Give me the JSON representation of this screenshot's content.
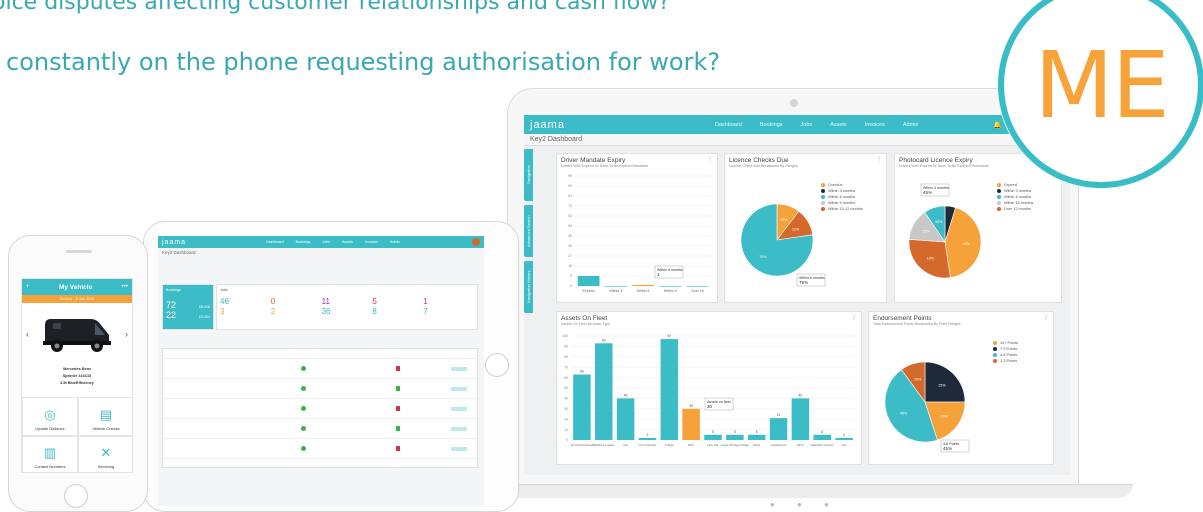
{
  "headline": {
    "line1": "oice disputes affecting customer relationships and cash flow?",
    "line2": "constantly on the phone requesting authorisation for work?"
  },
  "badge": {
    "text": "ME",
    "ring_color": "#38bcc6",
    "text_color": "#f7a33a"
  },
  "colors": {
    "brand": "#3cbcc6",
    "orange": "#f6a23a",
    "navy": "#1e2a3a",
    "grey": "#c8c8c8",
    "rust": "#d4692b"
  },
  "laptop": {
    "logo": "jaama",
    "nav": [
      "Dashboard",
      "Bookings",
      "Jobs",
      "Assets",
      "Invoices",
      "Admin"
    ],
    "icons": [
      "bell-icon",
      "gear-icon",
      "grid-icon"
    ],
    "subtitle": "Key2 Dashboard",
    "side_tabs": [
      "Navigation",
      "Advanced Search",
      "Navigation History"
    ],
    "mandate": {
      "title": "Driver Mandate Expiry",
      "subtitle": "Drivers With Expired Or Soon To Be Expired Mandates",
      "y_ticks": [
        "99",
        "90",
        "81",
        "72",
        "63",
        "54",
        "45",
        "36",
        "27",
        "18",
        "9",
        "0"
      ],
      "categories": [
        "Expired",
        "Within 3",
        "Within 6",
        "Within 9",
        "Over 18"
      ],
      "tooltip": [
        "Within 6 months",
        "1"
      ]
    },
    "licence": {
      "title": "Licence Checks Due",
      "subtitle": "Licence Check Due Breakdown By Ranges",
      "legend": [
        "Overdue",
        "Within 3 months",
        "Within 6 months",
        "Within 9 months",
        "Within 10-12 months"
      ],
      "tooltip": [
        "Within 6 months",
        "75%"
      ],
      "labels": [
        "75%",
        "12%",
        "10%"
      ]
    },
    "photocard": {
      "title": "Photocard Licence Expiry",
      "subtitle": "Drivers With Expired Or Soon To Be Expired Photocards",
      "legend": [
        "Expired",
        "Within 3 months",
        "Within 6 months",
        "Within 12 months",
        "Over 12 months"
      ],
      "tooltip": [
        "Within 3 months",
        "45%"
      ],
      "labels": [
        "45%",
        "30%",
        "15%",
        "10%"
      ]
    },
    "assets": {
      "title": "Assets On Fleet",
      "subtitle": "Assets On Fleet By Asset Type",
      "y_ticks": [
        "100",
        "90",
        "80",
        "70",
        "60",
        "50",
        "40",
        "30",
        "20",
        "10",
        "0"
      ],
      "tooltip": [
        "Assets on fleet",
        "30"
      ]
    },
    "endorsement": {
      "title": "Endorsement Points",
      "subtitle": "Total Endorsement Points Breakdown By Point Ranges",
      "legend": [
        "10+ Points",
        "7-9 Points",
        "4-6 Points",
        "1-3 Points"
      ],
      "tooltip": [
        "4-6 Points",
        "45%"
      ],
      "labels": [
        "45%",
        "25%",
        "20%",
        "10%"
      ]
    }
  },
  "chart_data": [
    {
      "type": "bar",
      "title": "Driver Mandate Expiry",
      "categories": [
        "Expired",
        "Within 3",
        "Within 6",
        "Within 9",
        "Over 18"
      ],
      "values": [
        9,
        0,
        1,
        0,
        0
      ],
      "ylim": [
        0,
        99
      ]
    },
    {
      "type": "pie",
      "title": "Licence Checks Due",
      "categories": [
        "Overdue",
        "Within 3 months",
        "Within 6 months"
      ],
      "values": [
        10,
        12,
        75
      ]
    },
    {
      "type": "pie",
      "title": "Photocard Licence Expiry",
      "categories": [
        "Expired",
        "Within 3 months",
        "Within 6 months",
        "Within 12 months",
        "Over 12 months"
      ],
      "values": [
        5,
        45,
        30,
        15,
        10
      ]
    },
    {
      "type": "bar",
      "title": "Assets On Fleet",
      "categories": [
        "1st Aid Retrained",
        "Backhoe Loader",
        "Car",
        "Car (Owned)",
        "Fridge",
        "HGV",
        "Hire Car",
        "Large Storage Fridge",
        "Plant",
        "Quickfreeze",
        "MCV",
        "Standard Courier",
        "Van"
      ],
      "values": [
        63,
        93,
        40,
        2,
        97,
        30,
        5,
        5,
        5,
        21,
        40,
        5,
        2
      ],
      "ylim": [
        0,
        100
      ]
    },
    {
      "type": "pie",
      "title": "Endorsement Points",
      "categories": [
        "10+ Points",
        "7-9 Points",
        "4-6 Points",
        "1-3 Points"
      ],
      "values": [
        25,
        20,
        45,
        10
      ]
    }
  ],
  "tablet": {
    "logo": "jaama",
    "nav": [
      "Dashboard",
      "Bookings",
      "Jobs",
      "Assets",
      "Invoices",
      "Admin"
    ],
    "subtitle": "Key2 Dashboard",
    "bookings_title": "Bookings",
    "jobs_title": "Jobs",
    "booking_numbers": [
      "72",
      "22"
    ],
    "booking_money": [
      "£6,018",
      "£5,304"
    ],
    "job_numbers": [
      "46",
      "3",
      "0",
      "2",
      "11",
      "36",
      "5",
      "8",
      "1",
      "7"
    ]
  },
  "phone": {
    "title": "My Vehicle",
    "service_bar": "Service - 6 Jan 2018",
    "vehicle": [
      "Mercedes-Benz",
      "Sprinter 316CDI",
      "3.5t BlueEfficiency"
    ],
    "tiles": [
      "Update Distance",
      "Vehicle Checks",
      "Contact Numbers",
      "Servicing"
    ]
  }
}
